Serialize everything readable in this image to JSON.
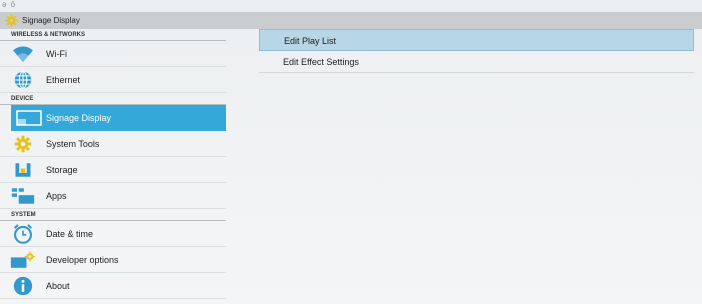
{
  "window": {
    "title": "Signage Display",
    "status_glyphs": "ə ō"
  },
  "sidebar": {
    "sections": [
      {
        "header": "WIRELESS & NETWORKS",
        "items": [
          {
            "label": "Wi-Fi",
            "icon": "wifi-icon"
          },
          {
            "label": "Ethernet",
            "icon": "globe-icon"
          }
        ]
      },
      {
        "header": "DEVICE",
        "items": [
          {
            "label": "Signage Display",
            "icon": "display-icon",
            "selected": true
          },
          {
            "label": "System Tools",
            "icon": "gear-icon"
          },
          {
            "label": "Storage",
            "icon": "storage-icon"
          },
          {
            "label": "Apps",
            "icon": "apps-icon"
          }
        ]
      },
      {
        "header": "SYSTEM",
        "items": [
          {
            "label": "Date & time",
            "icon": "clock-icon"
          },
          {
            "label": "Developer options",
            "icon": "developer-icon"
          },
          {
            "label": "About",
            "icon": "info-icon"
          }
        ]
      }
    ]
  },
  "content": {
    "items": [
      {
        "label": "Edit Play List",
        "active": true
      },
      {
        "label": "Edit Effect Settings"
      }
    ]
  },
  "colors": {
    "accent": "#34a8d8",
    "highlight": "#b8d7e6",
    "titlebar": "#c9cdd0",
    "icon_blue": "#3399cc"
  }
}
